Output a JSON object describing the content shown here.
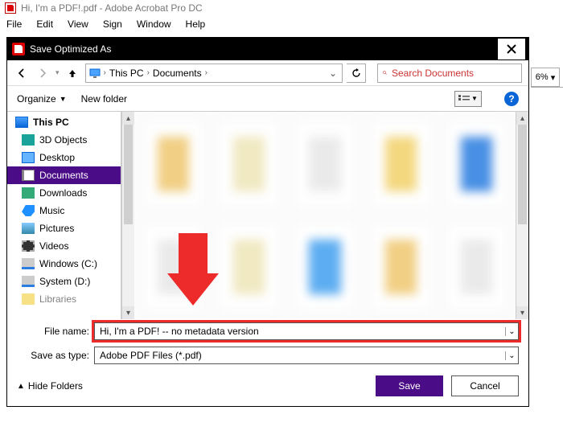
{
  "app": {
    "title": "Hi, I'm a PDF!.pdf - Adobe Acrobat Pro DC",
    "menu": {
      "file": "File",
      "edit": "Edit",
      "view": "View",
      "sign": "Sign",
      "window": "Window",
      "help": "Help"
    }
  },
  "dialog": {
    "title": "Save Optimized As",
    "breadcrumb": {
      "root": "This PC",
      "folder": "Documents"
    },
    "search": {
      "placeholder": "Search Documents"
    },
    "toolbar": {
      "organize": "Organize",
      "new_folder": "New folder"
    },
    "tree": {
      "this_pc": "This PC",
      "objects3d": "3D Objects",
      "desktop": "Desktop",
      "documents": "Documents",
      "downloads": "Downloads",
      "music": "Music",
      "pictures": "Pictures",
      "videos": "Videos",
      "win_c": "Windows (C:)",
      "sys_d": "System (D:)",
      "libraries": "Libraries"
    },
    "fields": {
      "filename_label": "File name:",
      "filename_value": "Hi, I'm a PDF! -- no metadata version",
      "type_label": "Save as type:",
      "type_value": "Adobe PDF Files (*.pdf)"
    },
    "footer": {
      "hide_folders": "Hide Folders",
      "save": "Save",
      "cancel": "Cancel"
    }
  },
  "right_panel": {
    "zoom": "6%"
  }
}
